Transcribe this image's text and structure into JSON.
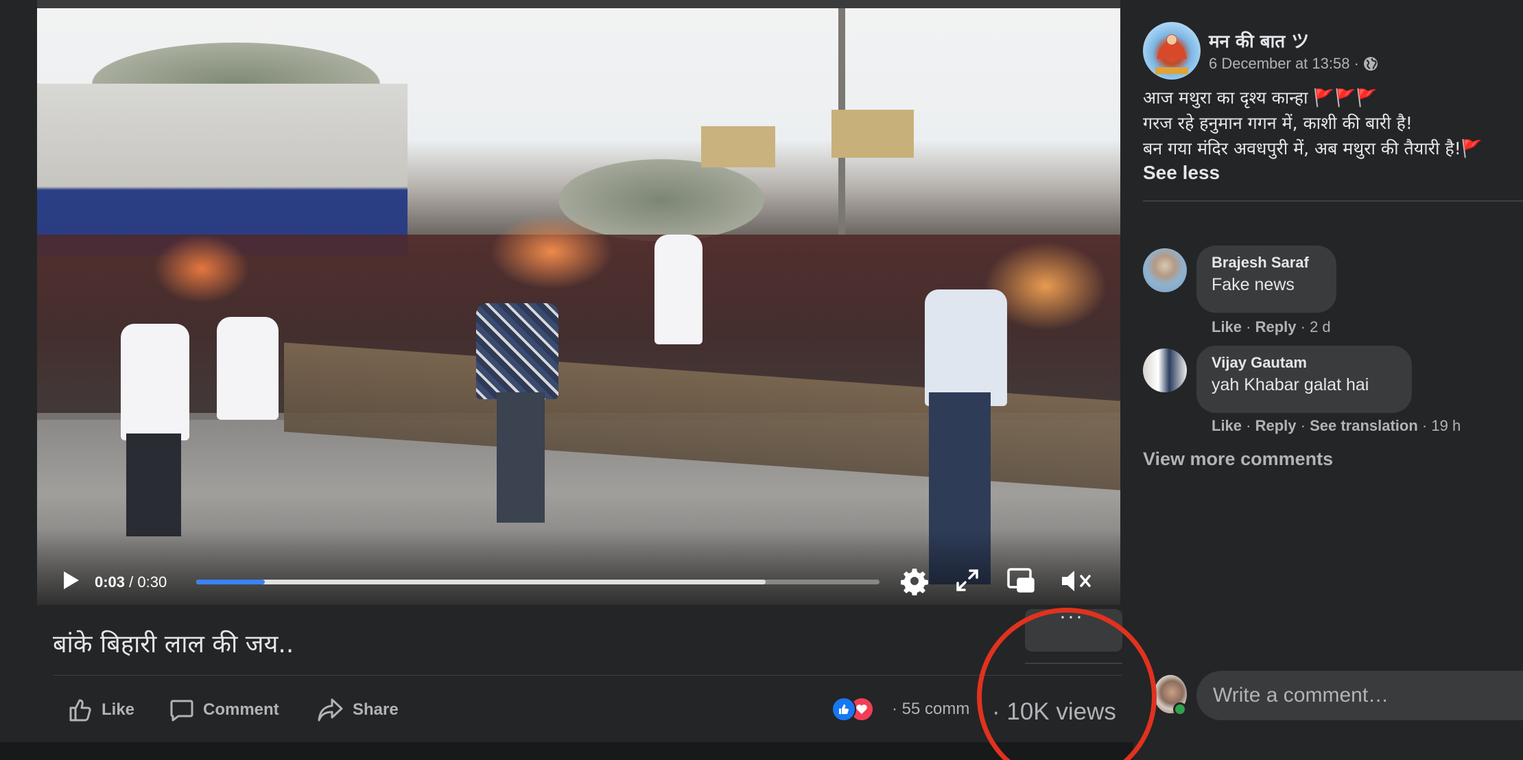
{
  "video": {
    "current_time": "0:03",
    "separator": "/",
    "duration": "0:30",
    "progress_fraction": 0.1,
    "buffered_fraction": 0.833
  },
  "post": {
    "page_name": "मन की बात ツ",
    "timestamp": "6 December at 13:58 ·",
    "text": "आज मथुरा का दृश्य कान्हा 🚩🚩🚩\nगरज रहे हनुमान गगन में, काशी की बारी है!\nबन गया मंदिर अवधपुरी में, अब मथुरा की तैयारी है!🚩",
    "see_less": "See less",
    "caption": "बांके बिहारी लाल की जय.."
  },
  "actions": {
    "like": "Like",
    "comment": "Comment",
    "share": "Share"
  },
  "stats": {
    "comments": "· 55 comm",
    "views": "· 10K views"
  },
  "more_pill_text": "···",
  "comments": [
    {
      "name": "Brajesh Saraf",
      "text": "Fake news",
      "like": "Like",
      "reply": "Reply",
      "time": "2 d"
    },
    {
      "name": "Vijay Gautam",
      "text": "yah Khabar galat hai",
      "like": "Like",
      "reply": "Reply",
      "translation": "See translation",
      "time": "19 h"
    }
  ],
  "view_more_comments": "View more comments",
  "comment_box": {
    "placeholder": "Write a comment…"
  },
  "colors": {
    "accent": "#1877f2",
    "love": "#f33e58",
    "annotation_circle": "#e0321f",
    "progress": "#3b82f6"
  },
  "icons": [
    "play-icon",
    "gear-icon",
    "fullscreen-icon",
    "pip-icon",
    "mute-icon",
    "like-icon",
    "comment-icon",
    "share-icon",
    "globe-icon",
    "like-reaction-icon",
    "love-reaction-icon"
  ]
}
